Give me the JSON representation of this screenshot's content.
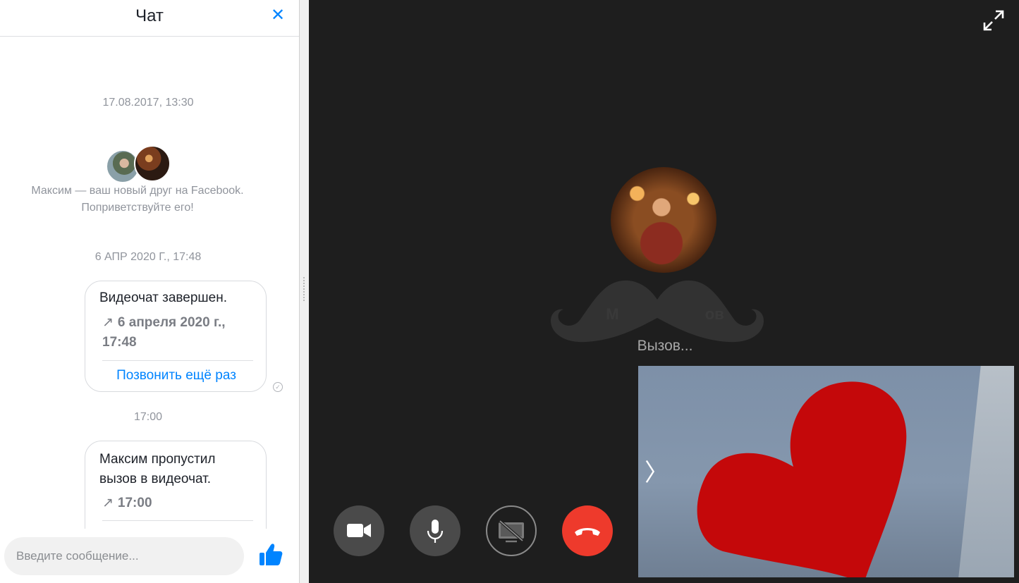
{
  "chat": {
    "title": "Чат",
    "close_icon": "close-icon",
    "timestamp_1": "17.08.2017, 13:30",
    "friend_notice_line1": "Максим — ваш новый друг на Facebook.",
    "friend_notice_line2": "Поприветствуйте его!",
    "timestamp_2": "6 АПР 2020 Г., 17:48",
    "bubble_1": {
      "title": "Видеочат завершен.",
      "meta_line1": "6 апреля 2020 г.,",
      "meta_line2": "17:48",
      "action": "Позвонить ещё раз"
    },
    "timestamp_3": "17:00",
    "bubble_2": {
      "title_line1": "Максим пропустил",
      "title_line2": "вызов в видеочат.",
      "meta": "17:00"
    },
    "composer": {
      "placeholder": "Введите сообщение...",
      "like_icon": "thumbs-up-icon",
      "accent": "#0084ff"
    }
  },
  "call": {
    "caller_name_visible": "М                    ов",
    "status": "Вызов...",
    "controls": {
      "video_icon": "video-camera-icon",
      "mic_icon": "microphone-icon",
      "screen_share_icon": "screen-share-off-icon",
      "end_call_icon": "hang-up-icon",
      "end_call_color": "#ee3a2c"
    },
    "fullscreen_icon": "expand-icon",
    "self_view_overlay": "heart-sticker",
    "collapse_icon": "chevron-right-icon"
  }
}
